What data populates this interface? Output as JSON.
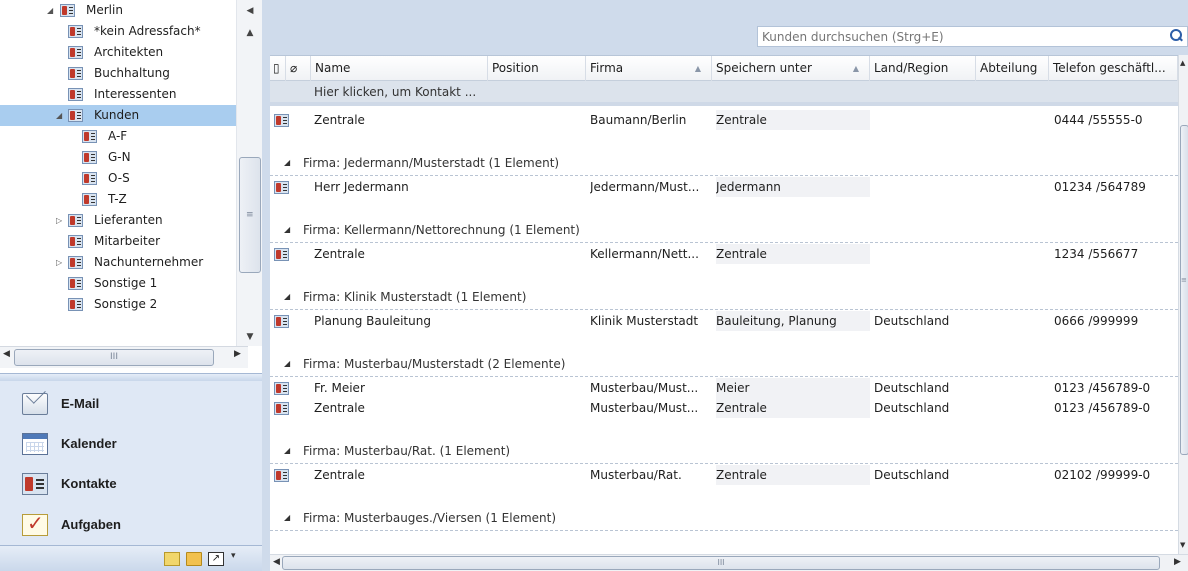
{
  "folders": {
    "root": "Merlin",
    "items": [
      {
        "label": "*kein Adressfach*",
        "level": 1,
        "expander": "",
        "selected": false
      },
      {
        "label": "Architekten",
        "level": 1,
        "expander": "",
        "selected": false
      },
      {
        "label": "Buchhaltung",
        "level": 1,
        "expander": "",
        "selected": false
      },
      {
        "label": "Interessenten",
        "level": 1,
        "expander": "",
        "selected": false
      },
      {
        "label": "Kunden",
        "level": 1,
        "expander": "expanded",
        "selected": true
      },
      {
        "label": "A-F",
        "level": 2,
        "expander": "",
        "selected": false
      },
      {
        "label": "G-N",
        "level": 2,
        "expander": "",
        "selected": false
      },
      {
        "label": "O-S",
        "level": 2,
        "expander": "",
        "selected": false
      },
      {
        "label": "T-Z",
        "level": 2,
        "expander": "",
        "selected": false
      },
      {
        "label": "Lieferanten",
        "level": 1,
        "expander": "collapsed",
        "selected": false
      },
      {
        "label": "Mitarbeiter",
        "level": 1,
        "expander": "",
        "selected": false
      },
      {
        "label": "Nachunternehmer",
        "level": 1,
        "expander": "collapsed",
        "selected": false
      },
      {
        "label": "Sonstige 1",
        "level": 1,
        "expander": "",
        "selected": false
      },
      {
        "label": "Sonstige 2",
        "level": 1,
        "expander": "",
        "selected": false
      }
    ]
  },
  "modules": {
    "mail": "E-Mail",
    "calendar": "Kalender",
    "contacts": "Kontakte",
    "tasks": "Aufgaben"
  },
  "search": {
    "placeholder": "Kunden durchsuchen (Strg+E)"
  },
  "columns": {
    "name": "Name",
    "position": "Position",
    "firma": "Firma",
    "speichern_unter": "Speichern unter",
    "land": "Land/Region",
    "abteilung": "Abteilung",
    "telefon": "Telefon geschäftl..."
  },
  "new_contact_label": "Hier klicken, um Kontakt ...",
  "list": [
    {
      "type": "row",
      "name": "Zentrale",
      "firma": "Baumann/Berlin",
      "speichern_unter": "Zentrale",
      "land": "",
      "telefon": "0444 /55555-0"
    },
    {
      "type": "group",
      "label": "Firma: Jedermann/Musterstadt (1 Element)"
    },
    {
      "type": "row",
      "name": "Herr Jedermann",
      "firma": "Jedermann/Must...",
      "speichern_unter": "Jedermann",
      "land": "",
      "telefon": "01234 /564789"
    },
    {
      "type": "group",
      "label": "Firma: Kellermann/Nettorechnung (1 Element)"
    },
    {
      "type": "row",
      "name": "Zentrale",
      "firma": "Kellermann/Nett...",
      "speichern_unter": "Zentrale",
      "land": "",
      "telefon": "1234 /556677"
    },
    {
      "type": "group",
      "label": "Firma: Klinik Musterstadt (1 Element)"
    },
    {
      "type": "row",
      "name": "Planung Bauleitung",
      "firma": "Klinik Musterstadt",
      "speichern_unter": "Bauleitung, Planung",
      "land": "Deutschland",
      "telefon": "0666 /999999"
    },
    {
      "type": "group",
      "label": "Firma: Musterbau/Musterstadt (2 Elemente)"
    },
    {
      "type": "row",
      "name": "Fr. Meier",
      "firma": "Musterbau/Must...",
      "speichern_unter": "Meier",
      "land": "Deutschland",
      "telefon": "0123 /456789-0"
    },
    {
      "type": "row",
      "name": "Zentrale",
      "firma": "Musterbau/Must...",
      "speichern_unter": "Zentrale",
      "land": "Deutschland",
      "telefon": "0123 /456789-0"
    },
    {
      "type": "group",
      "label": "Firma: Musterbau/Rat. (1 Element)"
    },
    {
      "type": "row",
      "name": "Zentrale",
      "firma": "Musterbau/Rat.",
      "speichern_unter": "Zentrale",
      "land": "Deutschland",
      "telefon": "02102 /99999-0"
    },
    {
      "type": "group",
      "label": "Firma: Musterbauges./Viersen (1 Element)"
    }
  ]
}
